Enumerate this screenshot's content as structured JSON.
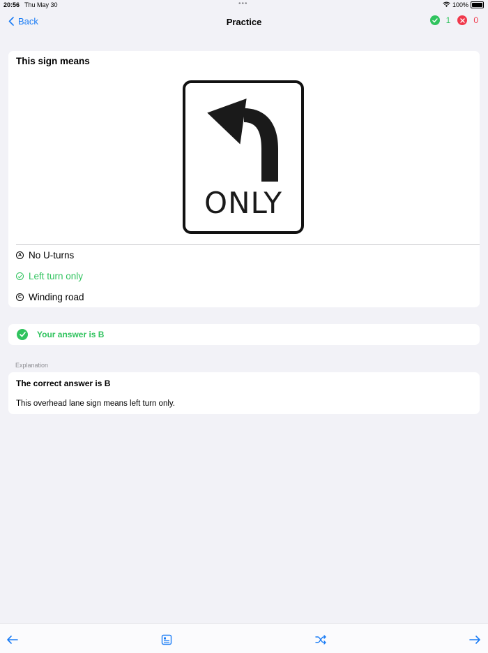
{
  "status": {
    "time": "20:56",
    "date": "Thu May 30",
    "battery": "100%"
  },
  "nav": {
    "back_label": "Back",
    "title": "Practice",
    "correct_count": "1",
    "wrong_count": "0"
  },
  "question": {
    "prompt": "This sign means",
    "sign_text": "ONLY",
    "options": [
      {
        "letter": "A",
        "label": "No U-turns",
        "state": "normal"
      },
      {
        "letter": "B",
        "label": "Left turn only",
        "state": "correct"
      },
      {
        "letter": "C",
        "label": "Winding road",
        "state": "normal"
      }
    ]
  },
  "answer": {
    "text": "Your answer is B"
  },
  "explanation": {
    "section_label": "Explanation",
    "title": "The correct answer is B",
    "body": "This overhead lane sign means left turn only."
  },
  "colors": {
    "accent": "#1a7cf5",
    "success": "#30c35e",
    "error": "#f0394c",
    "background": "#f2f2f7"
  },
  "toolbar": {
    "icons": [
      "arrow-left-icon",
      "card-icon",
      "shuffle-icon",
      "arrow-right-icon"
    ]
  }
}
